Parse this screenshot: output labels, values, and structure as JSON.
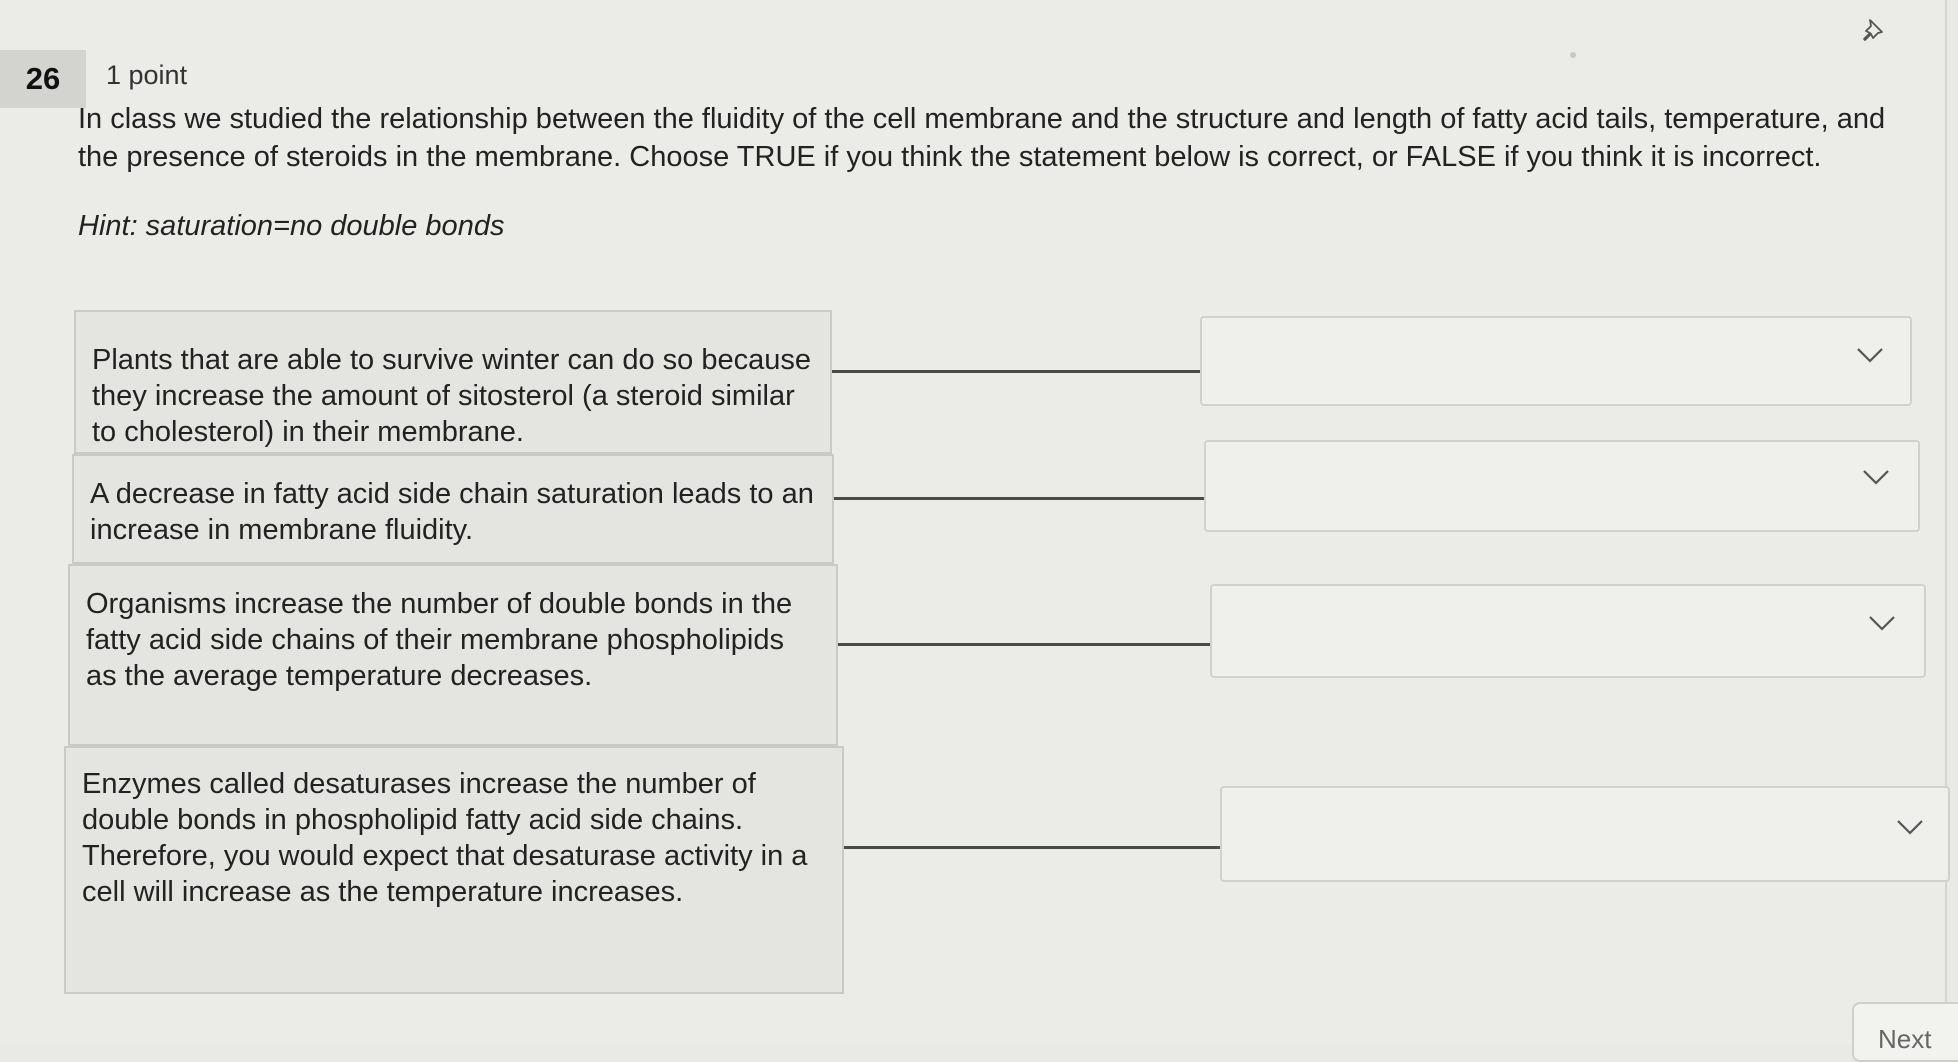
{
  "question": {
    "number": "26",
    "points": "1 point",
    "prompt": "In class we studied the relationship between the fluidity of the cell membrane and the structure and length of fatty acid tails, temperature, and the presence of steroids in the membrane. Choose TRUE if you think the statement below is correct, or FALSE if you think it is incorrect.",
    "hint": "Hint: saturation=no double bonds"
  },
  "statements": [
    {
      "text": "Plants that are able to survive winter can do so because they increase the amount of sitosterol (a steroid similar to cholesterol) in their membrane.",
      "selected": ""
    },
    {
      "text": "A decrease in fatty acid side chain saturation leads to an increase in membrane fluidity.",
      "selected": ""
    },
    {
      "text": "Organisms increase the number of double bonds in the fatty acid side chains of their membrane phospholipids as the average temperature decreases.",
      "selected": ""
    },
    {
      "text": "Enzymes called desaturases increase the number of double bonds in phospholipid fatty acid side chains. Therefore, you would expect that desaturase activity in a cell will increase as the temperature increases.",
      "selected": ""
    }
  ],
  "icons": {
    "pin": "pin-icon",
    "dropdown": "chevron-down-icon"
  },
  "navigation": {
    "next_label": "Next"
  }
}
